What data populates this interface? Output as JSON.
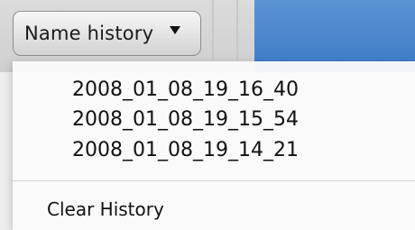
{
  "toolbar": {
    "history_button_label": "Name history"
  },
  "menu": {
    "items": [
      {
        "label": "2008_01_08_19_16_40"
      },
      {
        "label": "2008_01_08_19_15_54"
      },
      {
        "label": "2008_01_08_19_14_21"
      }
    ],
    "clear_label": "Clear History"
  }
}
